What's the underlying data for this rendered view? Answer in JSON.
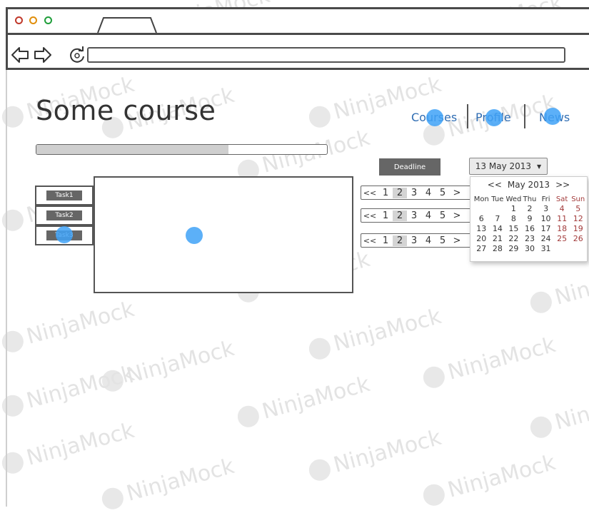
{
  "watermark": {
    "text": "NinjaMock"
  },
  "page": {
    "title": "Some course"
  },
  "nav": {
    "links": [
      "Courses",
      "Profile",
      "News"
    ]
  },
  "progress": {
    "fraction": 0.66
  },
  "deadline": {
    "label": "Deadline"
  },
  "date_picker": {
    "selected": "13 May 2013",
    "calendar": {
      "prev": "<<",
      "month": "May 2013",
      "next": ">>",
      "weekdays": [
        "Mon",
        "Tue",
        "Wed",
        "Thu",
        "Fri",
        "Sat",
        "Sun"
      ],
      "leading_blanks": 2,
      "days": [
        "1",
        "2",
        "3",
        "4",
        "5",
        "6",
        "7",
        "8",
        "9",
        "10",
        "11",
        "12",
        "13",
        "14",
        "15",
        "16",
        "17",
        "18",
        "19",
        "20",
        "21",
        "22",
        "23",
        "24",
        "25",
        "26",
        "27",
        "28",
        "29",
        "30",
        "31"
      ]
    }
  },
  "tasks": [
    "Task1",
    "Task2",
    "Task3"
  ],
  "pagers": [
    {
      "first": "<<",
      "pages": [
        "1",
        "2",
        "3",
        "4",
        "5"
      ],
      "active": "2",
      "next": ">"
    },
    {
      "first": "<<",
      "pages": [
        "1",
        "2",
        "3",
        "4",
        "5"
      ],
      "active": "2",
      "next": ">"
    },
    {
      "first": "<<",
      "pages": [
        "1",
        "2",
        "3",
        "4",
        "5"
      ],
      "active": "2",
      "next": ">"
    }
  ]
}
